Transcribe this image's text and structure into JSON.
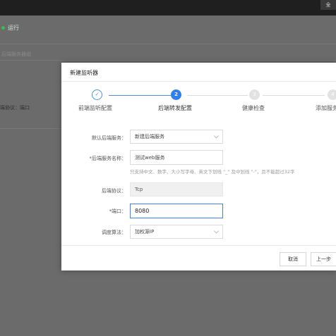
{
  "window": {
    "corner_button": "全"
  },
  "background": {
    "status_text": "运行",
    "status_color": "#3fb950",
    "row_label_partial": "后端服务器组",
    "protocol_label_partial": "端协议：端口"
  },
  "dialog": {
    "title": "新建监听器",
    "steps": [
      {
        "label": "前端监听配置",
        "number": "✓",
        "state": "done"
      },
      {
        "label": "后端转发配置",
        "number": "2",
        "state": "active"
      },
      {
        "label": "健康检查",
        "number": "3",
        "state": "todo"
      },
      {
        "label": "添加服务",
        "number": "4",
        "state": "todo"
      }
    ],
    "form": {
      "default_backend": {
        "label": "默认后端服务：",
        "value": "新建后端服务"
      },
      "backend_name": {
        "label": "*后端服务名称：",
        "value": "测试web服务",
        "hint": "只支持中文、数字、大小写字母、英文下划线 \"_\" 及中划线 \"-\"，且不能超过32字"
      },
      "backend_protocol": {
        "label": "后端协议：",
        "value": "Tcp"
      },
      "port": {
        "label": "*端口：",
        "value": "8080"
      },
      "scheduling": {
        "label": "调度算法：",
        "value": "加权源IP"
      }
    },
    "buttons": {
      "cancel": "取消",
      "previous": "上一步"
    }
  },
  "colors": {
    "accent": "#2f7ff0",
    "overlay": "#6b6b6b"
  }
}
